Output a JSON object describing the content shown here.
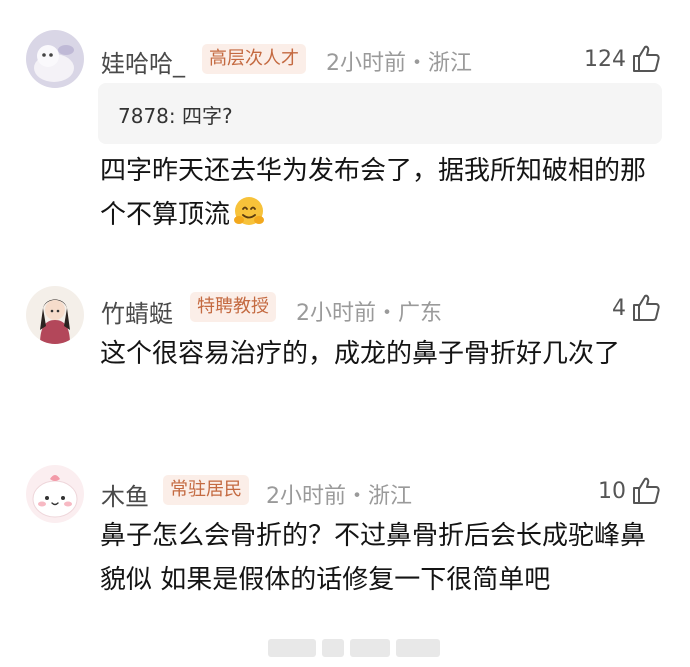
{
  "comments": [
    {
      "user": "娃哈哈_",
      "badge": "高层次人才",
      "meta": "2小时前・浙江",
      "likes": "124",
      "quote": "7878: 四字?",
      "text": "四字昨天还去华为发布会了，据我所知破相的那个不算顶流",
      "emoji": "hugging-face"
    },
    {
      "user": "竹蜻蜓",
      "badge": "特聘教授",
      "meta": "2小时前・广东",
      "likes": "4",
      "text": "这个很容易治疗的，成龙的鼻子骨折好几次了"
    },
    {
      "user": "木鱼",
      "badge": "常驻居民",
      "meta": "2小时前・浙江",
      "likes": "10",
      "text": "鼻子怎么会骨折的？不过鼻骨折后会长成驼峰鼻貌似 如果是假体的话修复一下很简单吧"
    }
  ],
  "colors": {
    "badge_bg": "#fbeee8",
    "badge_text": "#c46a41",
    "meta": "#9a9a9a",
    "quote_bg": "#f5f5f5"
  },
  "icons": [
    "thumbs-up-icon",
    "hugging-face-emoji"
  ]
}
